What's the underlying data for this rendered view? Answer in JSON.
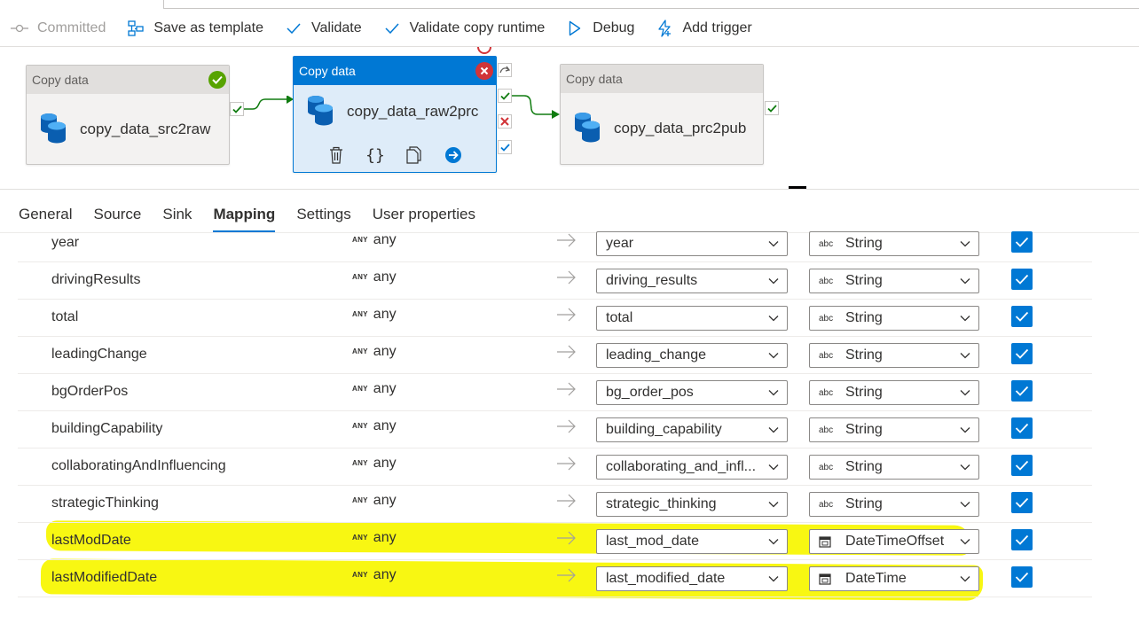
{
  "toolbar": {
    "committed": "Committed",
    "save_as_template": "Save as template",
    "validate": "Validate",
    "validate_copy_runtime": "Validate copy runtime",
    "debug": "Debug",
    "add_trigger": "Add trigger"
  },
  "pipeline": {
    "nodes": [
      {
        "header": "Copy data",
        "name": "copy_data_src2raw"
      },
      {
        "header": "Copy data",
        "name": "copy_data_raw2prc"
      },
      {
        "header": "Copy data",
        "name": "copy_data_prc2pub"
      }
    ]
  },
  "tabs": [
    "General",
    "Source",
    "Sink",
    "Mapping",
    "Settings",
    "User properties"
  ],
  "active_tab": "Mapping",
  "mapping": {
    "rows": [
      {
        "source": "year",
        "source_type": "any",
        "any_tag": "ANY",
        "dest": "year",
        "dest_type": "String",
        "type_icon": "abc",
        "checked": true
      },
      {
        "source": "drivingResults",
        "source_type": "any",
        "any_tag": "ANY",
        "dest": "driving_results",
        "dest_type": "String",
        "type_icon": "abc",
        "checked": true
      },
      {
        "source": "total",
        "source_type": "any",
        "any_tag": "ANY",
        "dest": "total",
        "dest_type": "String",
        "type_icon": "abc",
        "checked": true
      },
      {
        "source": "leadingChange",
        "source_type": "any",
        "any_tag": "ANY",
        "dest": "leading_change",
        "dest_type": "String",
        "type_icon": "abc",
        "checked": true
      },
      {
        "source": "bgOrderPos",
        "source_type": "any",
        "any_tag": "ANY",
        "dest": "bg_order_pos",
        "dest_type": "String",
        "type_icon": "abc",
        "checked": true
      },
      {
        "source": "buildingCapability",
        "source_type": "any",
        "any_tag": "ANY",
        "dest": "building_capability",
        "dest_type": "String",
        "type_icon": "abc",
        "checked": true
      },
      {
        "source": "collaboratingAndInfluencing",
        "source_type": "any",
        "any_tag": "ANY",
        "dest": "collaborating_and_infl...",
        "dest_type": "String",
        "type_icon": "abc",
        "checked": true
      },
      {
        "source": "strategicThinking",
        "source_type": "any",
        "any_tag": "ANY",
        "dest": "strategic_thinking",
        "dest_type": "String",
        "type_icon": "abc",
        "checked": true
      },
      {
        "source": "lastModDate",
        "source_type": "any",
        "any_tag": "ANY",
        "dest": "last_mod_date",
        "dest_type": "DateTimeOffset",
        "type_icon": "calendar",
        "checked": true
      },
      {
        "source": "lastModifiedDate",
        "source_type": "any",
        "any_tag": "ANY",
        "dest": "last_modified_date",
        "dest_type": "DateTime",
        "type_icon": "calendar",
        "checked": true
      }
    ]
  },
  "colors": {
    "accent": "#0078d4",
    "success": "#107c10",
    "error": "#d13438",
    "highlight": "#f8f600"
  }
}
